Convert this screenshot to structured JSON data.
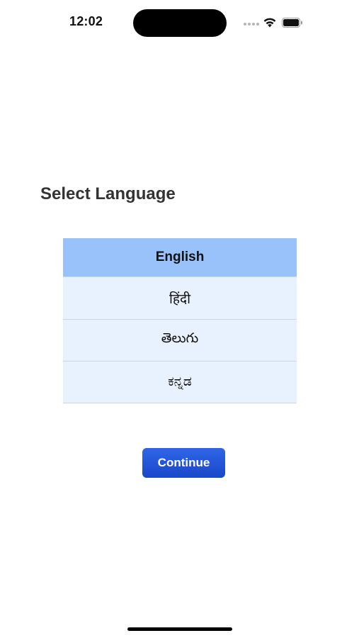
{
  "status_bar": {
    "time": "12:02",
    "icons": [
      "signal-dots-icon",
      "wifi-icon",
      "battery-icon"
    ]
  },
  "title": "Select Language",
  "languages": [
    {
      "label": "English",
      "selected": true
    },
    {
      "label": "हिंदी",
      "selected": false
    },
    {
      "label": "తెలుగు",
      "selected": false
    },
    {
      "label": "ಕನ್ನಡ",
      "selected": false
    }
  ],
  "continue_label": "Continue",
  "colors": {
    "selected_row": "#99c2fb",
    "unselected_row": "#e8f1fe",
    "button": "#1f4fd6",
    "title_text": "#333333"
  }
}
